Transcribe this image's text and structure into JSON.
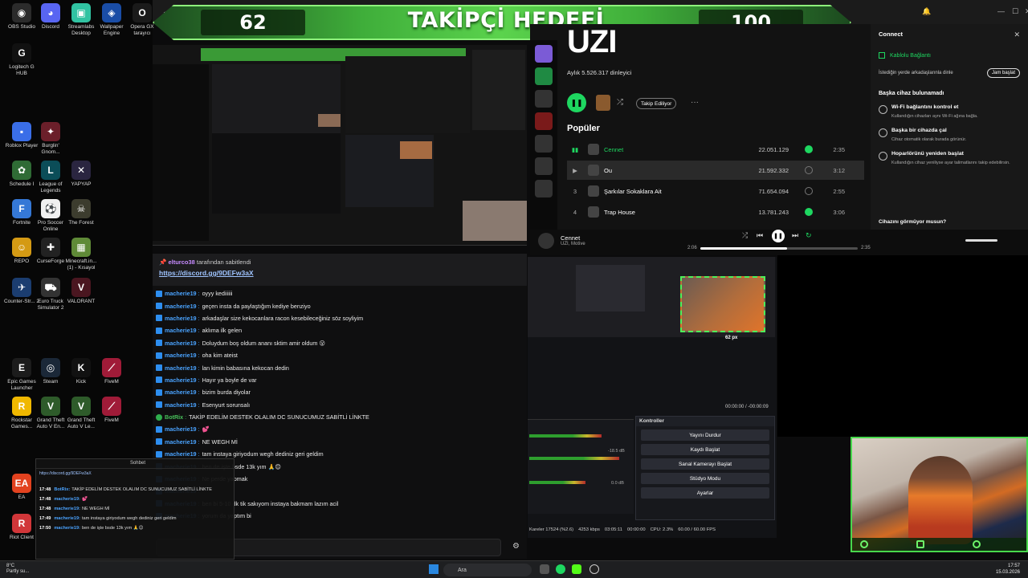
{
  "desktop": {
    "icons": [
      {
        "label": "OBS Studio",
        "color": "#2b2b2b",
        "glyph": "◉"
      },
      {
        "label": "Discord",
        "color": "#5865f2",
        "glyph": "◕"
      },
      {
        "label": "Streamlabs Desktop",
        "color": "#31c3a2",
        "glyph": "▣"
      },
      {
        "label": "Wallpaper Engine",
        "color": "#1a4da6",
        "glyph": "◈"
      },
      {
        "label": "Opera GX tarayıcı",
        "color": "#1a1a1a",
        "glyph": "O"
      },
      {
        "label": "Logitech G HUB",
        "color": "#111",
        "glyph": "G"
      },
      {
        "label": "Roblox Player",
        "color": "#3a6ee8",
        "glyph": "▪"
      },
      {
        "label": "Burglin' Gnom...",
        "color": "#6b1f2a",
        "glyph": "✦"
      },
      {
        "label": "Schedule I",
        "color": "#2f6b35",
        "glyph": "✿"
      },
      {
        "label": "League of Legends",
        "color": "#0b4d58",
        "glyph": "L"
      },
      {
        "label": "YAPYAP",
        "color": "#2a2540",
        "glyph": "✕"
      },
      {
        "label": "Fortnite",
        "color": "#3578d6",
        "glyph": "F"
      },
      {
        "label": "Pro Soccer Online",
        "color": "#f0f0f0",
        "glyph": "⚽"
      },
      {
        "label": "The Forest",
        "color": "#3c3c2e",
        "glyph": "☠"
      },
      {
        "label": "REPO",
        "color": "#d49a14",
        "glyph": "☺"
      },
      {
        "label": "CurseForge",
        "color": "#222",
        "glyph": "✚"
      },
      {
        "label": "Minecraft.in... (1) - Kısayol",
        "color": "#5f8a37",
        "glyph": "▦"
      },
      {
        "label": "Counter-Str... 2",
        "color": "#1b3d70",
        "glyph": "✈"
      },
      {
        "label": "Euro Truck Simulator 2",
        "color": "#333",
        "glyph": "⛟"
      },
      {
        "label": "VALORANT",
        "color": "#4a1620",
        "glyph": "V"
      },
      {
        "label": "Epic Games Launcher",
        "color": "#1c1c1c",
        "glyph": "E"
      },
      {
        "label": "Steam",
        "color": "#1b2838",
        "glyph": "◎"
      },
      {
        "label": "Kick",
        "color": "#111",
        "glyph": "K"
      },
      {
        "label": "FiveM",
        "color": "#a01b38",
        "glyph": "⟋"
      },
      {
        "label": "Rockstar Games...",
        "color": "#f0b800",
        "glyph": "R"
      },
      {
        "label": "Grand Theft Auto V En...",
        "color": "#2e5b2a",
        "glyph": "V"
      },
      {
        "label": "Grand Theft Auto V Le...",
        "color": "#2e5b2a",
        "glyph": "V"
      },
      {
        "label": "FiveM",
        "color": "#a01b38",
        "glyph": "⟋"
      },
      {
        "label": "EA",
        "color": "#e2421f",
        "glyph": "EA"
      },
      {
        "label": "Riot Client",
        "color": "#d13639",
        "glyph": "R"
      }
    ]
  },
  "banner": {
    "current": "62",
    "title": "TAKİPÇİ HEDEFİ",
    "goal": "100"
  },
  "pinned": {
    "user": "elturco38",
    "suffix": "tarafından sabitlendi",
    "link": "https://discord.gg/9DEFw3aX"
  },
  "chat": [
    {
      "user": "macherie19",
      "text": "oyyy kediiiiii",
      "bot": false
    },
    {
      "user": "macherie19",
      "text": "geçen insta da paylaştığım kediye benziyo",
      "bot": false
    },
    {
      "user": "macherie19",
      "text": "arkadaşlar size kekocanlara racon kesebileceğiniz söz soyliyim",
      "bot": false
    },
    {
      "user": "macherie19",
      "text": "aklıma ilk gelen",
      "bot": false
    },
    {
      "user": "macherie19",
      "text": "Doluydum boş oldum ananı sktim amir oldum 😮",
      "bot": false
    },
    {
      "user": "macherie19",
      "text": "oha kim ateist",
      "bot": false
    },
    {
      "user": "macherie19",
      "text": "lan kimin babasına kekocan dedin",
      "bot": false
    },
    {
      "user": "macherie19",
      "text": "Hayır ya boyle de var",
      "bot": false
    },
    {
      "user": "macherie19",
      "text": "bizim burda diyolar",
      "bot": false
    },
    {
      "user": "macherie19",
      "text": "Esenyurt sorunsalı",
      "bot": false
    },
    {
      "user": "BotRix",
      "text": "TAKİP EDELİM DESTEK OLALIM DC SUNUCUMUZ SABİTLİ LİNKTE",
      "bot": true
    },
    {
      "user": "macherie19",
      "text": "💕",
      "bot": false
    },
    {
      "user": "macherie19",
      "text": "NE WEGH Mİ",
      "bot": false
    },
    {
      "user": "macherie19",
      "text": "tam instaya giriyodum wegh dediniz geri geldim",
      "bot": false
    },
    {
      "user": "macherie19",
      "text": "ben de işte bsde 13k yım 🙏😊",
      "bot": false
    },
    {
      "user": "macherie19",
      "text": "Ne perde yapmak",
      "bot": false
    },
    {
      "user": "macherie19",
      "text": "",
      "bot": false
    },
    {
      "user": "macherie19",
      "text": "ben bi 5-10 dk tik sakıyom instaya bakmam lazım acil",
      "bot": false
    },
    {
      "user": "macherie19",
      "text": "yorum da yaptım bi",
      "bot": false
    }
  ],
  "spotify": {
    "artist": "UZI",
    "listeners": "Aylık 5.526.317 dinleyici",
    "follow_label": "Takip Ediliyor",
    "popular_label": "Popüler",
    "tracks": [
      {
        "num": "",
        "title": "Cennet",
        "plays": "22.051.129",
        "duration": "2:35",
        "liked": true,
        "active": true
      },
      {
        "num": "▶",
        "title": "Ou",
        "plays": "21.592.332",
        "duration": "3:12",
        "liked": false,
        "active": false
      },
      {
        "num": "3",
        "title": "Şarkılar Sokaklara Ait",
        "plays": "71.654.094",
        "duration": "2:55",
        "liked": false,
        "active": false
      },
      {
        "num": "4",
        "title": "Trap House",
        "plays": "13.781.243",
        "duration": "3:06",
        "liked": true,
        "active": false
      }
    ],
    "now_playing": {
      "title": "Cennet",
      "artist": "UZI, Motive",
      "elapsed": "2:06",
      "total": "2:35",
      "progress": 0.55
    }
  },
  "connect": {
    "title": "Connect",
    "device": "Kablolu Bağlantı",
    "invite_text": "İstediğin yerde arkadaşlarınla dinle",
    "jam_label": "Jam başlat",
    "no_device": "Başka cihaz bulunamadı",
    "items": [
      {
        "title": "Wi-Fi bağlantını kontrol et",
        "desc": "Kullandığın cihazları aynı Wi-Fi ağına bağla."
      },
      {
        "title": "Başka bir cihazda çal",
        "desc": "Cihaz otomatik olarak burada görünür."
      },
      {
        "title": "Hoparlörünü yeniden başlat",
        "desc": "Kullandığın cihaz yeniliyse ayar talimatlarını takip edebilirsin."
      }
    ],
    "footer": "Cihazını görmüyor musun?"
  },
  "obs": {
    "size_text": "62 px",
    "timer": "00:00:00  /  -00:00:09",
    "controls_title": "Kontroller",
    "buttons": [
      "Yayını Durdur",
      "Kaydı Başlat",
      "Sanal Kamerayı Başlat",
      "Stüdyo Modu",
      "Ayarlar"
    ],
    "status": [
      "Kareler 17524 (%2.6)",
      "4253 kbps",
      "03:05:11",
      "00:00:00",
      "CPU: 2.3%",
      "60.00 / 60.00 FPS"
    ],
    "mixer_levels": [
      "-18.5 dB",
      "0.0 dB"
    ]
  },
  "minichat": {
    "header": "Sohbet",
    "rows": [
      {
        "time": "17:48",
        "user": "BotRix:",
        "text": "TAKİP EDELİM DESTEK OLALIM DC SUNUCUMUZ SABİTLİ LİNKTE"
      },
      {
        "time": "17:48",
        "user": "macherie19:",
        "text": "💕"
      },
      {
        "time": "17:48",
        "user": "macherie19:",
        "text": "NE WEGH Mİ"
      },
      {
        "time": "17:49",
        "user": "macherie19:",
        "text": "tam instaya giriyodum wegh dediniz geri geldim"
      },
      {
        "time": "17:50",
        "user": "macherie19:",
        "text": "ben de işte bsde 13k yım 🙏😊"
      }
    ]
  },
  "taskbar": {
    "weather_temp": "8°C",
    "weather_desc": "Partly su...",
    "search_placeholder": "Ara",
    "time": "17:57",
    "date": "15.03.2026"
  }
}
